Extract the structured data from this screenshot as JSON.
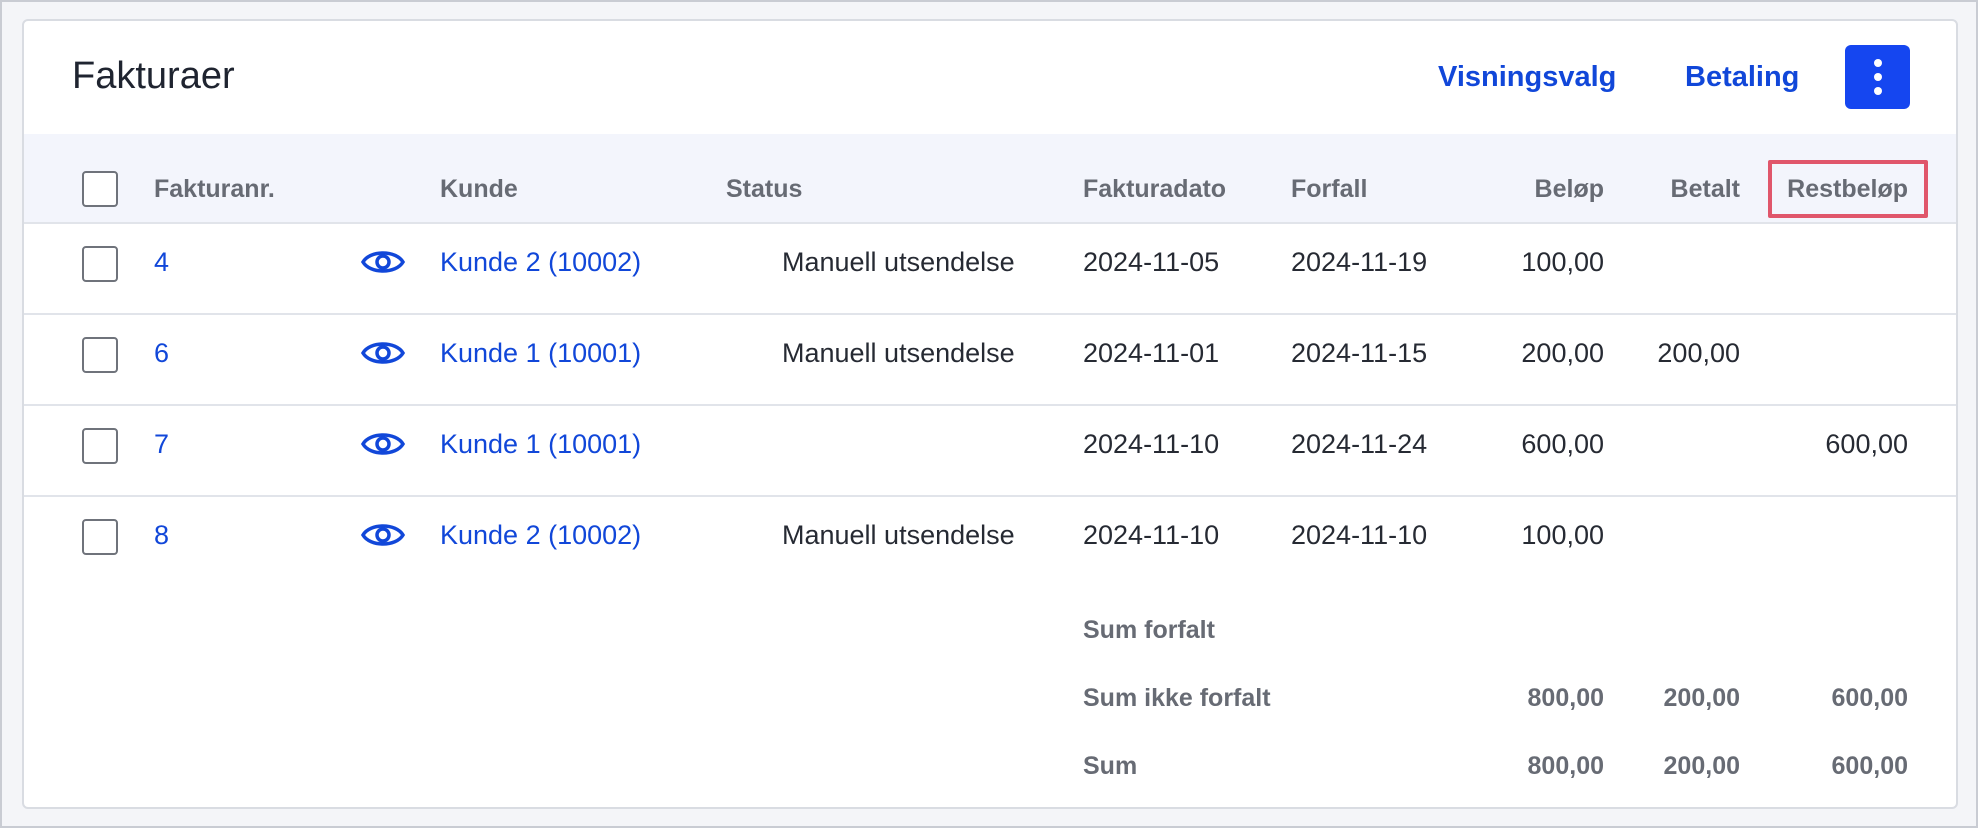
{
  "header": {
    "title": "Fakturaer",
    "view_options_label": "Visningsvalg",
    "payment_label": "Betaling",
    "more_icon": "more-vertical-icon"
  },
  "table": {
    "columns": {
      "invoice_no": "Fakturanr.",
      "customer": "Kunde",
      "status": "Status",
      "invoice_date": "Fakturadato",
      "due": "Forfall",
      "amount": "Beløp",
      "paid": "Betalt",
      "remaining": "Restbeløp"
    },
    "highlight_color": "#e0566b",
    "rows": [
      {
        "invoice_no": "4",
        "customer": "Kunde 2 (10002)",
        "status": "Manuell utsendelse",
        "invoice_date": "2024-11-05",
        "due": "2024-11-19",
        "amount": "100,00",
        "paid": "",
        "remaining": ""
      },
      {
        "invoice_no": "6",
        "customer": "Kunde 1 (10001)",
        "status": "Manuell utsendelse",
        "invoice_date": "2024-11-01",
        "due": "2024-11-15",
        "amount": "200,00",
        "paid": "200,00",
        "remaining": ""
      },
      {
        "invoice_no": "7",
        "customer": "Kunde 1 (10001)",
        "status": "",
        "invoice_date": "2024-11-10",
        "due": "2024-11-24",
        "amount": "600,00",
        "paid": "",
        "remaining": "600,00"
      },
      {
        "invoice_no": "8",
        "customer": "Kunde 2 (10002)",
        "status": "Manuell utsendelse",
        "invoice_date": "2024-11-10",
        "due": "2024-11-10",
        "amount": "100,00",
        "paid": "",
        "remaining": ""
      }
    ],
    "totals": [
      {
        "label": "Sum forfalt",
        "amount": "",
        "paid": "",
        "remaining": ""
      },
      {
        "label": "Sum ikke forfalt",
        "amount": "800,00",
        "paid": "200,00",
        "remaining": "600,00"
      },
      {
        "label": "Sum",
        "amount": "800,00",
        "paid": "200,00",
        "remaining": "600,00"
      }
    ]
  },
  "colors": {
    "link": "#1147d9",
    "primary_button": "#1546f0",
    "header_bg": "#f3f5fc"
  }
}
